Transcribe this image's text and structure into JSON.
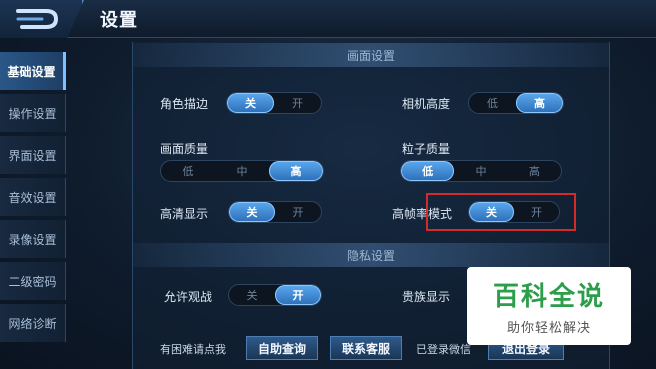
{
  "header": {
    "title": "设置"
  },
  "sidebar": {
    "items": [
      {
        "label": "基础设置",
        "active": true
      },
      {
        "label": "操作设置"
      },
      {
        "label": "界面设置"
      },
      {
        "label": "音效设置"
      },
      {
        "label": "录像设置"
      },
      {
        "label": "二级密码"
      },
      {
        "label": "网络诊断"
      }
    ]
  },
  "display": {
    "section_title": "画面设置",
    "role_outline": {
      "label": "角色描边",
      "options": [
        "关",
        "开"
      ],
      "selected": "关"
    },
    "camera_height": {
      "label": "相机高度",
      "options": [
        "低",
        "高"
      ],
      "selected": "高"
    },
    "picture_quality": {
      "label": "画面质量",
      "options": [
        "低",
        "中",
        "高"
      ],
      "selected": "高"
    },
    "particle_quality": {
      "label": "粒子质量",
      "options": [
        "低",
        "中",
        "高"
      ],
      "selected": "低"
    },
    "hd_display": {
      "label": "高清显示",
      "options": [
        "关",
        "开"
      ],
      "selected": "关"
    },
    "high_fps": {
      "label": "高帧率模式",
      "options": [
        "关",
        "开"
      ],
      "selected": "关"
    }
  },
  "privacy": {
    "section_title": "隐私设置",
    "allow_spectate": {
      "label": "允许观战",
      "options": [
        "关",
        "开"
      ],
      "selected": "开"
    },
    "noble_display": {
      "label": "贵族显示"
    }
  },
  "footer": {
    "help_text": "有困难请点我",
    "self_service": "自助查询",
    "contact_support": "联系客服",
    "logged_in": "已登录微信",
    "logout": "退出登录"
  },
  "watermark": {
    "title": "百科全说",
    "subtitle": "助你轻松解决",
    "color": "#2c9d4a"
  }
}
